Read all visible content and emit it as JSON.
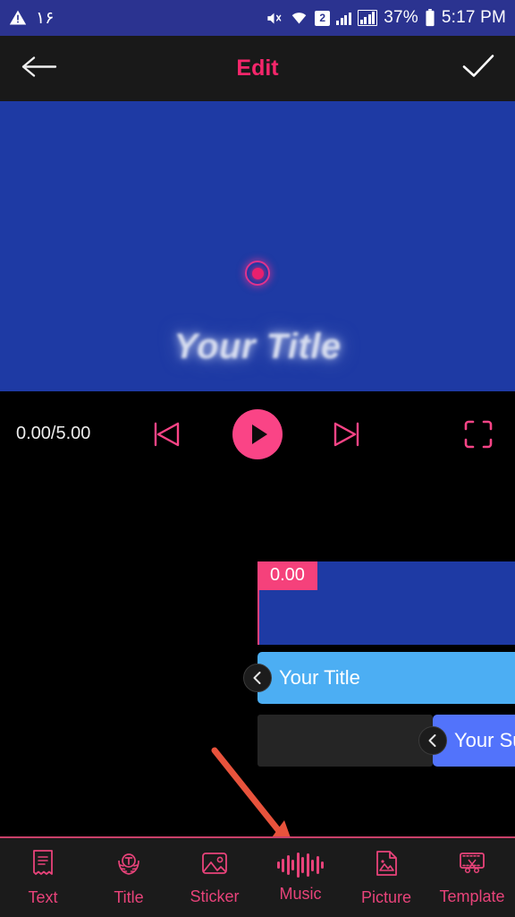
{
  "statusbar": {
    "warning_icon": "warning-triangle-icon",
    "left_number": "۱۶",
    "mute_icon": "mute-icon",
    "wifi_icon": "wifi-icon",
    "sim_badge": "2",
    "battery_percent": "37%",
    "battery_icon": "battery-icon",
    "time": "5:17 PM"
  },
  "header": {
    "back_icon": "arrow-left-icon",
    "title": "Edit",
    "done_icon": "check-icon"
  },
  "preview": {
    "background_color": "#1E3AA4",
    "marker_color": "#E8206E",
    "title_text": "Your Title"
  },
  "player": {
    "time_display": "0.00/5.00",
    "current_time": "0.00",
    "total_time": "5.00",
    "prev_icon": "skip-previous-icon",
    "play_icon": "play-icon",
    "next_icon": "skip-next-icon",
    "fullscreen_icon": "fullscreen-icon",
    "accent_color": "#FA4486"
  },
  "timeline": {
    "video_track": {
      "badge": "0.00",
      "color": "#1E3AA4",
      "badge_color": "#F5417B"
    },
    "title_track": {
      "label": "Your Title",
      "color": "#4CAEF3",
      "handle_icon": "chevron-left-icon"
    },
    "subtitle_track": {
      "label": "Your Su",
      "color": "#5273FB",
      "handle_icon": "chevron-left-icon"
    }
  },
  "annotation": {
    "arrow_color": "#E8533C",
    "points_to": "Music"
  },
  "navbar": {
    "items": [
      {
        "label": "Text",
        "icon": "text-document-icon"
      },
      {
        "label": "Title",
        "icon": "title-laurel-icon"
      },
      {
        "label": "Sticker",
        "icon": "sticker-image-icon"
      },
      {
        "label": "Music",
        "icon": "music-waveform-icon"
      },
      {
        "label": "Picture",
        "icon": "picture-file-icon"
      },
      {
        "label": "Template",
        "icon": "template-filmstrip-icon"
      }
    ],
    "accent_color": "#E8437A"
  }
}
